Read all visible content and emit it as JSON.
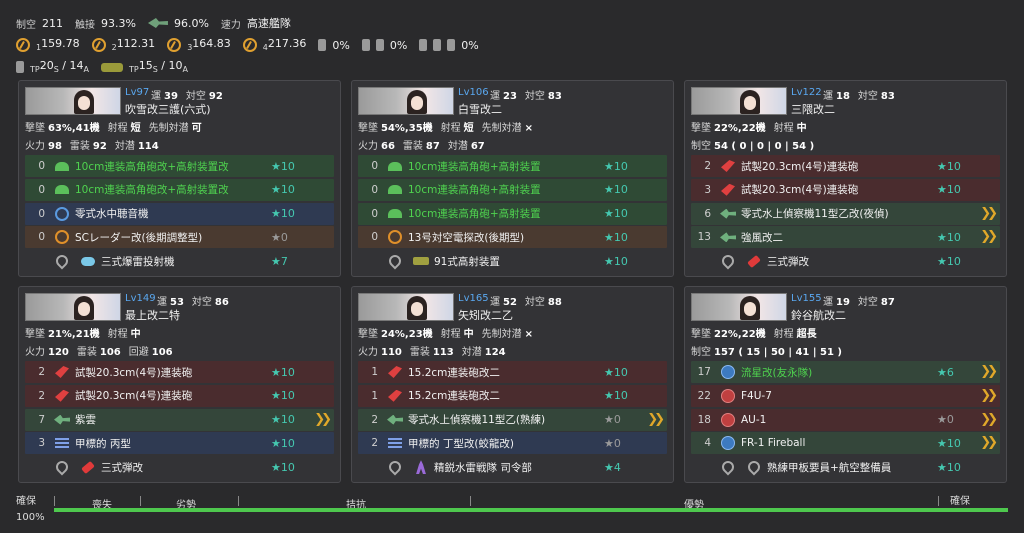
{
  "fleet_summary": {
    "air_superiority_label": "制空",
    "air_superiority": "211",
    "contact_label": "触接",
    "contact": "93.3%",
    "contact2": "96.0%",
    "speed_label": "速力",
    "speed": "高速艦隊",
    "los": [
      "159.78",
      "112.31",
      "164.83",
      "217.36"
    ],
    "los_subs": [
      "1",
      "2",
      "3",
      "4"
    ],
    "drums": [
      "0%",
      "0%",
      "0%"
    ],
    "tp_s": "20",
    "tp_s_unit": "S",
    "tp_a": "14",
    "tp_a_unit": "A",
    "tp2_s": "15",
    "tp2_a": "10",
    "tp_label": "TP"
  },
  "ships": [
    {
      "lv": "Lv97",
      "luck_label": "運",
      "luck": "39",
      "aa_label": "対空",
      "aa": "92",
      "name": "吹雪改三護(六式)",
      "info1": [
        [
          "撃墜",
          "63%,41機"
        ],
        [
          "射程",
          "短"
        ],
        [
          "先制対潜",
          "可"
        ]
      ],
      "info2": [
        [
          "火力",
          "98"
        ],
        [
          "雷装",
          "92"
        ],
        [
          "対潜",
          "114"
        ]
      ],
      "slots": [
        {
          "count": "0",
          "icon": "gun",
          "name": "10cm連装高角砲改+高射装置改",
          "star": "★10",
          "bg": "green",
          "green": true
        },
        {
          "count": "0",
          "icon": "gun",
          "name": "10cm連装高角砲改+高射装置改",
          "star": "★10",
          "bg": "green",
          "green": true
        },
        {
          "count": "0",
          "icon": "circle",
          "name": "零式水中聴音機",
          "star": "★10",
          "bg": "blue"
        },
        {
          "count": "0",
          "icon": "ocircle",
          "name": "SCレーダー改(後期調整型)",
          "star": "★0",
          "bg": "orange",
          "grey": true
        },
        {
          "count": "",
          "icon": "wrench+depth",
          "name": "三式爆雷投射機",
          "star": "★7",
          "bg": "none"
        }
      ]
    },
    {
      "lv": "Lv106",
      "luck_label": "運",
      "luck": "23",
      "aa_label": "対空",
      "aa": "83",
      "name": "白雪改二",
      "info1": [
        [
          "撃墜",
          "54%,35機"
        ],
        [
          "射程",
          "短"
        ],
        [
          "先制対潜",
          "×"
        ]
      ],
      "info2": [
        [
          "火力",
          "66"
        ],
        [
          "雷装",
          "87"
        ],
        [
          "対潜",
          "67"
        ]
      ],
      "slots": [
        {
          "count": "0",
          "icon": "gun",
          "name": "10cm連装高角砲+高射装置",
          "star": "★10",
          "bg": "green",
          "green": true
        },
        {
          "count": "0",
          "icon": "gun",
          "name": "10cm連装高角砲+高射装置",
          "star": "★10",
          "bg": "green",
          "green": true
        },
        {
          "count": "0",
          "icon": "gun",
          "name": "10cm連装高角砲+高射装置",
          "star": "★10",
          "bg": "green",
          "green": true
        },
        {
          "count": "0",
          "icon": "ocircle",
          "name": "13号対空電探改(後期型)",
          "star": "★10",
          "bg": "orange"
        },
        {
          "count": "",
          "icon": "wrench+tank",
          "name": "91式高射装置",
          "star": "★10",
          "bg": "none"
        }
      ]
    },
    {
      "lv": "Lv122",
      "luck_label": "運",
      "luck": "18",
      "aa_label": "対空",
      "aa": "83",
      "name": "三隈改二",
      "info1": [
        [
          "撃墜",
          "22%,22機"
        ],
        [
          "射程",
          "中"
        ]
      ],
      "info2": [
        [
          "制空",
          "54 ( 0 | 0 | 0 | 54 )"
        ]
      ],
      "slots": [
        {
          "count": "2",
          "icon": "redgun",
          "name": "試製20.3cm(4号)連装砲",
          "star": "★10",
          "bg": "red"
        },
        {
          "count": "3",
          "icon": "redgun",
          "name": "試製20.3cm(4号)連装砲",
          "star": "★10",
          "bg": "red"
        },
        {
          "count": "6",
          "icon": "plane",
          "name": "零式水上偵察機11型乙改(夜偵)",
          "star": "",
          "bg": "dgreen",
          "prof": true
        },
        {
          "count": "13",
          "icon": "plane",
          "name": "強風改二",
          "star": "★10",
          "bg": "dgreen",
          "prof": true
        },
        {
          "count": "",
          "icon": "wrench+ammo",
          "name": "三式弾改",
          "star": "★10",
          "bg": "none"
        }
      ]
    },
    {
      "lv": "Lv149",
      "luck_label": "運",
      "luck": "53",
      "aa_label": "対空",
      "aa": "86",
      "name": "最上改二特",
      "info1": [
        [
          "撃墜",
          "21%,21機"
        ],
        [
          "射程",
          "中"
        ]
      ],
      "info2": [
        [
          "火力",
          "120"
        ],
        [
          "雷装",
          "106"
        ],
        [
          "回避",
          "106"
        ]
      ],
      "slots": [
        {
          "count": "2",
          "icon": "redgun",
          "name": "試製20.3cm(4号)連装砲",
          "star": "★10",
          "bg": "red"
        },
        {
          "count": "2",
          "icon": "redgun",
          "name": "試製20.3cm(4号)連装砲",
          "star": "★10",
          "bg": "red"
        },
        {
          "count": "7",
          "icon": "plane",
          "name": "紫雲",
          "star": "★10",
          "bg": "dgreen",
          "prof": true
        },
        {
          "count": "3",
          "icon": "lines",
          "name": "甲標的 丙型",
          "star": "★10",
          "bg": "blue"
        },
        {
          "count": "",
          "icon": "wrench+ammo",
          "name": "三式弾改",
          "star": "★10",
          "bg": "none"
        }
      ]
    },
    {
      "lv": "Lv165",
      "luck_label": "運",
      "luck": "52",
      "aa_label": "対空",
      "aa": "88",
      "name": "矢矧改二乙",
      "info1": [
        [
          "撃墜",
          "24%,23機"
        ],
        [
          "射程",
          "中"
        ],
        [
          "先制対潜",
          "×"
        ]
      ],
      "info2": [
        [
          "火力",
          "110"
        ],
        [
          "雷装",
          "113"
        ],
        [
          "対潜",
          "124"
        ]
      ],
      "slots": [
        {
          "count": "1",
          "icon": "redgun",
          "name": "15.2cm連装砲改二",
          "star": "★10",
          "bg": "red"
        },
        {
          "count": "1",
          "icon": "redgun",
          "name": "15.2cm連装砲改二",
          "star": "★10",
          "bg": "red"
        },
        {
          "count": "2",
          "icon": "plane",
          "name": "零式水上偵察機11型乙(熟練)",
          "star": "★0",
          "bg": "dgreen",
          "grey": true,
          "prof": true
        },
        {
          "count": "2",
          "icon": "lines",
          "name": "甲標的 丁型改(蛟龍改)",
          "star": "★0",
          "bg": "blue",
          "grey": true
        },
        {
          "count": "",
          "icon": "wrench+person",
          "name": "精鋭水雷戦隊 司令部",
          "star": "★4",
          "bg": "none"
        }
      ]
    },
    {
      "lv": "Lv155",
      "luck_label": "運",
      "luck": "19",
      "aa_label": "対空",
      "aa": "87",
      "name": "鈴谷航改二",
      "info1": [
        [
          "撃墜",
          "22%,22機"
        ],
        [
          "射程",
          "超長"
        ]
      ],
      "info2": [
        [
          "制空",
          "157 ( 15 | 50 | 41 | 51 )"
        ]
      ],
      "slots": [
        {
          "count": "17",
          "icon": "fighter",
          "name": "流星改(友永隊)",
          "star": "★6",
          "bg": "dgreen",
          "green": true,
          "prof": true
        },
        {
          "count": "22",
          "icon": "redplane",
          "name": "F4U-7",
          "star": "",
          "bg": "red",
          "prof": true
        },
        {
          "count": "18",
          "icon": "redplane",
          "name": "AU-1",
          "star": "★0",
          "bg": "red",
          "grey": true,
          "prof": true
        },
        {
          "count": "4",
          "icon": "fighter",
          "name": "FR-1 Fireball",
          "star": "★10",
          "bg": "dgreen",
          "prof": true
        },
        {
          "count": "",
          "icon": "wrench+wrench",
          "name": "熟練甲板要員+航空整備員",
          "star": "★10",
          "bg": "none"
        }
      ]
    }
  ],
  "air_bar": {
    "left_label": "確保",
    "right_label": "確保",
    "pct": "100%",
    "ticks": [
      "喪失",
      "劣勢",
      "拮抗",
      "優勢"
    ],
    "fill": 1.0
  }
}
